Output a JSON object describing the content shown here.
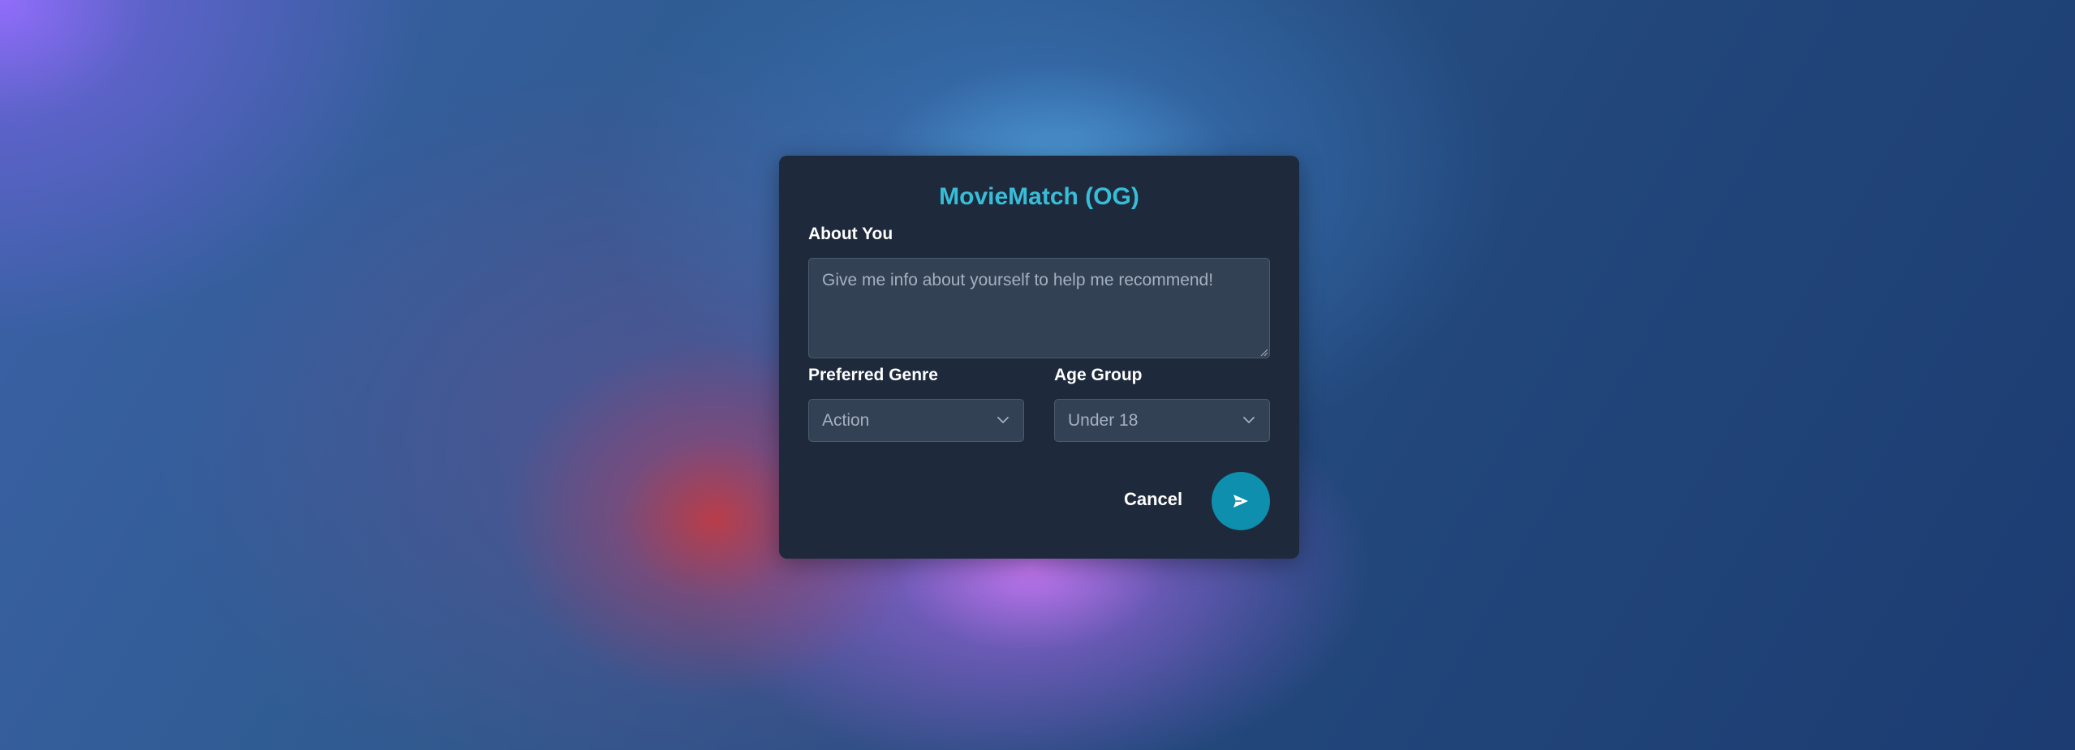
{
  "app": {
    "title": "MovieMatch (OG)"
  },
  "form": {
    "about_label": "About You",
    "about_placeholder": "Give me info about yourself to help me recommend!",
    "genre_label": "Preferred Genre",
    "genre_value": "Action",
    "age_label": "Age Group",
    "age_value": "Under 18"
  },
  "actions": {
    "cancel_label": "Cancel",
    "send_icon": "send-icon"
  },
  "colors": {
    "title": "#38bdd8",
    "dialog_bg": "#1e293b",
    "field_bg": "#334155",
    "send_button": "#0e8fad"
  }
}
